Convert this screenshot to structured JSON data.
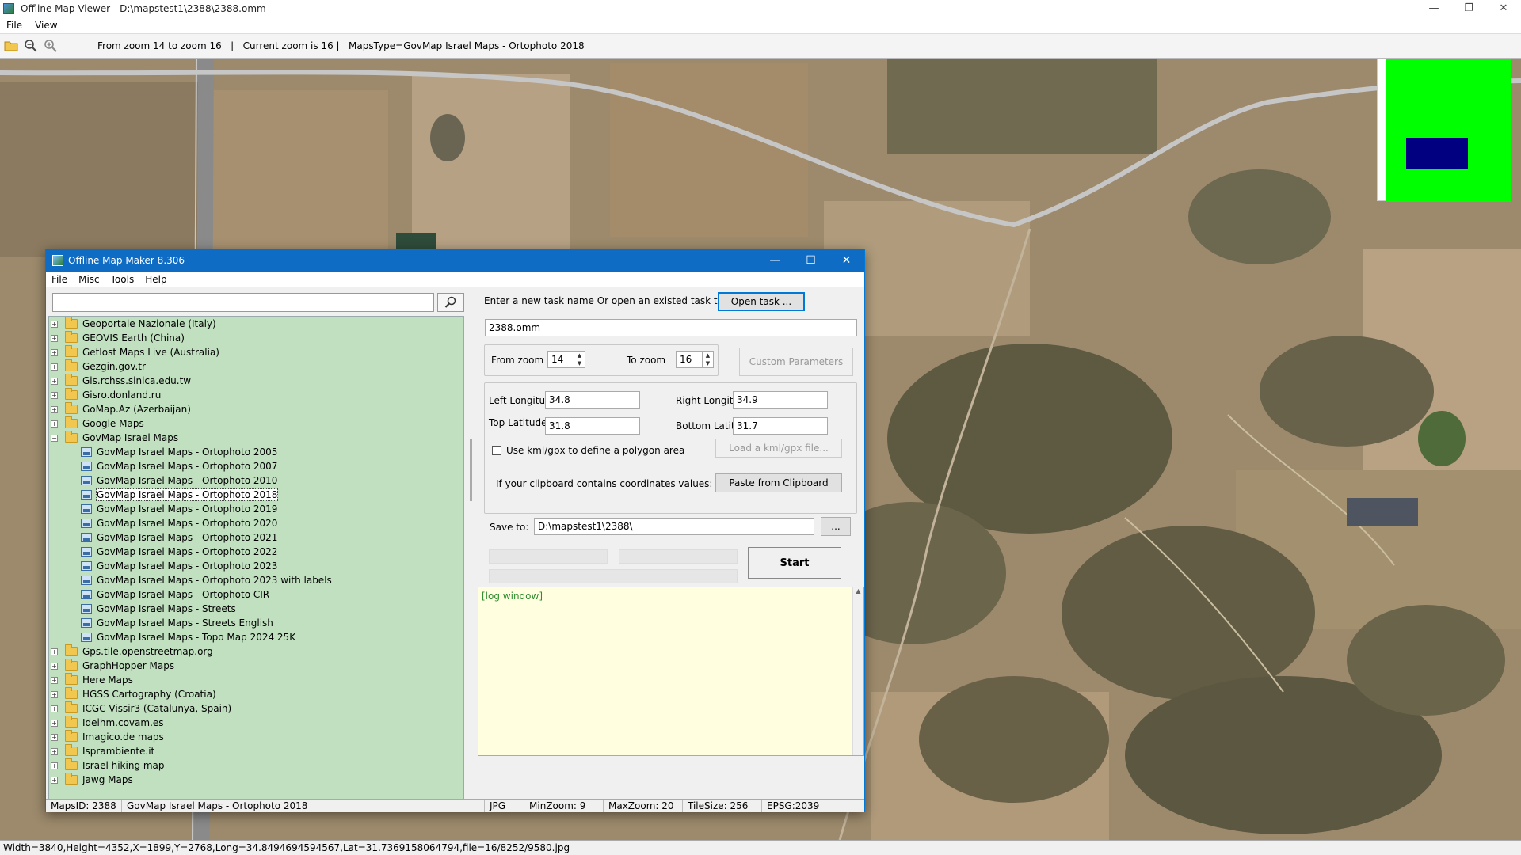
{
  "viewer": {
    "title": "Offline Map Viewer - D:\\mapstest1\\2388\\2388.omm",
    "menu": [
      "File",
      "View"
    ],
    "toolbar_info": "From zoom 14 to zoom 16   |   Current zoom is 16 |   MapsType=GovMap Israel Maps - Ortophoto 2018",
    "status": "Width=3840,Height=4352,X=1899,Y=2768,Long=34.8494694594567,Lat=31.7369158064794,file=16/8252/9580.jpg",
    "minimap_colors": {
      "background": "#00ff00",
      "viewport": "#000080"
    }
  },
  "omm": {
    "title": "Offline Map Maker 8.306",
    "menu": [
      "File",
      "Misc",
      "Tools",
      "Help"
    ],
    "search_placeholder": "",
    "tree": [
      {
        "label": "Geoportale Nazionale (Italy)",
        "level": 0,
        "expander": "+",
        "type": "folder"
      },
      {
        "label": "GEOVIS Earth (China)",
        "level": 0,
        "expander": "+",
        "type": "folder"
      },
      {
        "label": "Getlost Maps Live (Australia)",
        "level": 0,
        "expander": "+",
        "type": "folder"
      },
      {
        "label": "Gezgin.gov.tr",
        "level": 0,
        "expander": "+",
        "type": "folder"
      },
      {
        "label": "Gis.rchss.sinica.edu.tw",
        "level": 0,
        "expander": "+",
        "type": "folder"
      },
      {
        "label": "Gisro.donland.ru",
        "level": 0,
        "expander": "+",
        "type": "folder"
      },
      {
        "label": "GoMap.Az (Azerbaijan)",
        "level": 0,
        "expander": "+",
        "type": "folder"
      },
      {
        "label": "Google Maps",
        "level": 0,
        "expander": "+",
        "type": "folder"
      },
      {
        "label": "GovMap Israel Maps",
        "level": 0,
        "expander": "−",
        "type": "folder"
      },
      {
        "label": "GovMap Israel Maps - Ortophoto 2005",
        "level": 1,
        "type": "map"
      },
      {
        "label": "GovMap Israel Maps - Ortophoto 2007",
        "level": 1,
        "type": "map"
      },
      {
        "label": "GovMap Israel Maps - Ortophoto 2010",
        "level": 1,
        "type": "map"
      },
      {
        "label": "GovMap Israel Maps - Ortophoto 2018",
        "level": 1,
        "type": "map",
        "selected": true
      },
      {
        "label": "GovMap Israel Maps - Ortophoto 2019",
        "level": 1,
        "type": "map"
      },
      {
        "label": "GovMap Israel Maps - Ortophoto 2020",
        "level": 1,
        "type": "map"
      },
      {
        "label": "GovMap Israel Maps - Ortophoto 2021",
        "level": 1,
        "type": "map"
      },
      {
        "label": "GovMap Israel Maps - Ortophoto 2022",
        "level": 1,
        "type": "map"
      },
      {
        "label": "GovMap Israel Maps - Ortophoto 2023",
        "level": 1,
        "type": "map"
      },
      {
        "label": "GovMap Israel Maps - Ortophoto 2023 with labels",
        "level": 1,
        "type": "map"
      },
      {
        "label": "GovMap Israel Maps - Ortophoto CIR",
        "level": 1,
        "type": "map"
      },
      {
        "label": "GovMap Israel Maps - Streets",
        "level": 1,
        "type": "map"
      },
      {
        "label": "GovMap Israel Maps - Streets English",
        "level": 1,
        "type": "map"
      },
      {
        "label": "GovMap Israel Maps - Topo Map 2024 25K",
        "level": 1,
        "type": "map"
      },
      {
        "label": "Gps.tile.openstreetmap.org",
        "level": 0,
        "expander": "+",
        "type": "folder"
      },
      {
        "label": "GraphHopper Maps",
        "level": 0,
        "expander": "+",
        "type": "folder"
      },
      {
        "label": "Here Maps",
        "level": 0,
        "expander": "+",
        "type": "folder"
      },
      {
        "label": "HGSS Cartography (Croatia)",
        "level": 0,
        "expander": "+",
        "type": "folder"
      },
      {
        "label": "ICGC Vissir3 (Catalunya, Spain)",
        "level": 0,
        "expander": "+",
        "type": "folder"
      },
      {
        "label": "Ideihm.covam.es",
        "level": 0,
        "expander": "+",
        "type": "folder"
      },
      {
        "label": "Imagico.de maps",
        "level": 0,
        "expander": "+",
        "type": "folder"
      },
      {
        "label": "Isprambiente.it",
        "level": 0,
        "expander": "+",
        "type": "folder"
      },
      {
        "label": "Israel hiking map",
        "level": 0,
        "expander": "+",
        "type": "folder"
      },
      {
        "label": "Jawg Maps",
        "level": 0,
        "expander": "+",
        "type": "folder"
      }
    ],
    "task_prompt": "Enter a new task name Or open an existed task to continue:",
    "open_task_label": "Open task ...",
    "task_name": "2388.omm",
    "from_zoom_label": "From zoom",
    "from_zoom": "14",
    "to_zoom_label": "To zoom",
    "to_zoom": "16",
    "custom_params_label": "Custom Parameters",
    "left_lon_label": "Left Longitude",
    "left_lon": "34.8",
    "right_lon_label": "Right Longitude",
    "right_lon": "34.9",
    "top_lat_label": "Top Latitude",
    "top_lat": "31.8",
    "bottom_lat_label": "Bottom Latitude",
    "bottom_lat": "31.7",
    "kml_label": "Use kml/gpx to define a polygon area",
    "load_kml_label": "Load a kml/gpx file...",
    "clipboard_label": "If your clipboard contains coordinates values:",
    "paste_label": "Paste from Clipboard",
    "save_to_label": "Save to:",
    "save_to": "D:\\mapstest1\\2388\\",
    "browse_label": "...",
    "start_label": "Start",
    "log_text": "[log window]",
    "status": {
      "maps_id": "MapsID: 2388",
      "map_name": "GovMap Israel Maps - Ortophoto 2018",
      "format": "JPG",
      "min_zoom": "MinZoom: 9",
      "max_zoom": "MaxZoom: 20",
      "tile_size": "TileSize: 256",
      "epsg": "EPSG:2039"
    }
  }
}
